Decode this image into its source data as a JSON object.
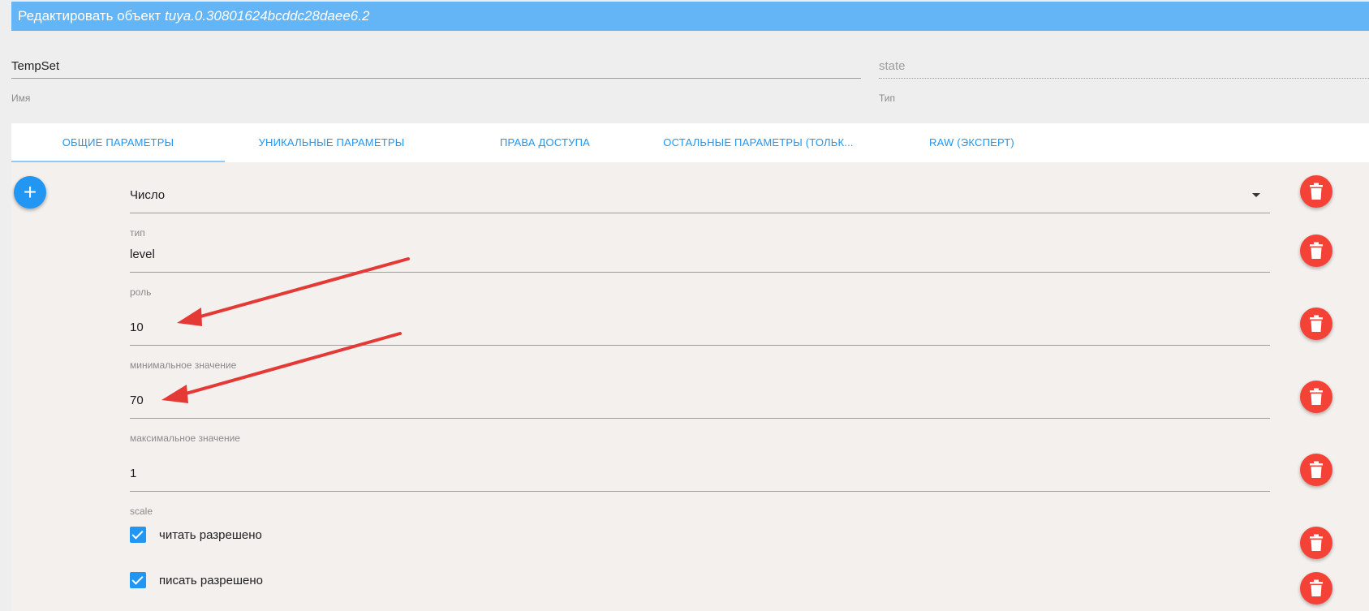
{
  "dialog": {
    "title_prefix": "Редактировать объект",
    "object_id": "tuya.0.30801624bcddc28daee6.2"
  },
  "name_field": {
    "value": "TempSet",
    "label": "Имя"
  },
  "type_field": {
    "value": "state",
    "label": "Тип"
  },
  "tabs": [
    {
      "label": "ОБЩИЕ ПАРАМЕТРЫ",
      "active": true
    },
    {
      "label": "УНИКАЛЬНЫЕ ПАРАМЕТРЫ",
      "active": false
    },
    {
      "label": "ПРАВА ДОСТУПА",
      "active": false
    },
    {
      "label": "ОСТАЛЬНЫЕ ПАРАМЕТРЫ (ТОЛЬК...",
      "active": false
    },
    {
      "label": "RAW (ЭКСПЕРТ)",
      "active": false
    }
  ],
  "add_button": {
    "icon": "plus-icon"
  },
  "fields": {
    "type": {
      "value": "Число",
      "label": "тип"
    },
    "role": {
      "value": "level",
      "label": "роль"
    },
    "min": {
      "value": "10",
      "label": "минимальное значение"
    },
    "max": {
      "value": "70",
      "label": "максимальное значение"
    },
    "scale": {
      "value": "1",
      "label": "scale"
    }
  },
  "checkboxes": {
    "read": {
      "label": "читать разрешено",
      "checked": true
    },
    "write": {
      "label": "писать разрешено",
      "checked": true
    }
  },
  "icons": {
    "delete": "trash-icon",
    "dropdown": "chevron-down-icon"
  },
  "colors": {
    "title_bar": "#64b5f6",
    "accent": "#2196f3",
    "delete": "#f44336",
    "annotation_arrow": "#e53935"
  }
}
